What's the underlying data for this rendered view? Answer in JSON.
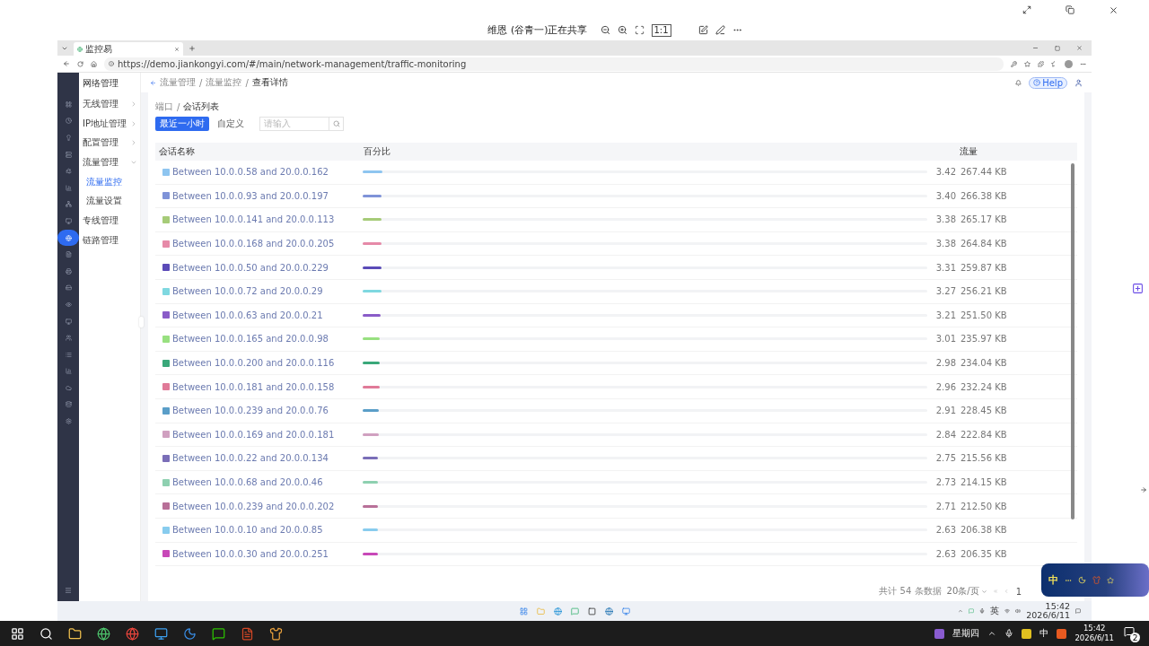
{
  "share_bar": {
    "text": "维恩 (谷青一)正在共享",
    "fit_label": "1:1"
  },
  "browser": {
    "tab_title": "监控易",
    "url": "https://demo.jiankongyi.com/#/main/network-management/traffic-monitoring"
  },
  "rail_items": [
    {
      "selected": false
    },
    {
      "selected": false
    },
    {
      "selected": false
    },
    {
      "selected": false
    },
    {
      "selected": false
    },
    {
      "selected": false
    },
    {
      "selected": false
    },
    {
      "selected": false
    },
    {
      "selected": true
    },
    {
      "selected": false
    },
    {
      "selected": false
    },
    {
      "selected": false
    },
    {
      "selected": false
    },
    {
      "selected": false
    },
    {
      "selected": false
    },
    {
      "selected": false
    },
    {
      "selected": false
    },
    {
      "selected": false
    },
    {
      "selected": false
    },
    {
      "selected": false
    }
  ],
  "sidebar": {
    "title": "网络管理",
    "items": [
      {
        "label": "无线管理",
        "expanded": false
      },
      {
        "label": "IP地址管理",
        "expanded": false
      },
      {
        "label": "配置管理",
        "expanded": false
      },
      {
        "label": "流量管理",
        "expanded": true,
        "children": [
          {
            "label": "流量监控",
            "selected": true
          },
          {
            "label": "流量设置",
            "selected": false
          }
        ]
      },
      {
        "label": "专线管理"
      },
      {
        "label": "链路管理"
      }
    ]
  },
  "header": {
    "breadcrumb": [
      "流量管理",
      "流量监控",
      "查看详情"
    ],
    "separator": "/",
    "help": "Help"
  },
  "content": {
    "breadcrumb": [
      "端口",
      "会话列表"
    ],
    "separator": "/",
    "ranges": [
      {
        "label": "最近一小时",
        "selected": true
      },
      {
        "label": "自定义",
        "selected": false
      }
    ],
    "search": {
      "placeholder": "请输入"
    },
    "columns": [
      "会话名称",
      "百分比",
      "流量"
    ],
    "rows": [
      {
        "name": "Between 10.0.0.58 and 20.0.0.162",
        "color": "#8ec5f0",
        "level": 0.0342,
        "percent": "3.42",
        "traffic": "267.44 KB"
      },
      {
        "name": "Between 10.0.0.93 and 20.0.0.197",
        "color": "#7f93d8",
        "level": 0.034,
        "percent": "3.40",
        "traffic": "266.38 KB"
      },
      {
        "name": "Between 10.0.0.141 and 20.0.0.113",
        "color": "#a6cb78",
        "level": 0.0338,
        "percent": "3.38",
        "traffic": "265.17 KB"
      },
      {
        "name": "Between 10.0.0.168 and 20.0.0.205",
        "color": "#e68aa8",
        "level": 0.0338,
        "percent": "3.38",
        "traffic": "264.84 KB"
      },
      {
        "name": "Between 10.0.0.50 and 20.0.0.229",
        "color": "#5b4bb8",
        "level": 0.0331,
        "percent": "3.31",
        "traffic": "259.87 KB"
      },
      {
        "name": "Between 10.0.0.72 and 20.0.0.29",
        "color": "#7fd8e0",
        "level": 0.0327,
        "percent": "3.27",
        "traffic": "256.21 KB"
      },
      {
        "name": "Between 10.0.0.63 and 20.0.0.21",
        "color": "#8a5cc8",
        "level": 0.0321,
        "percent": "3.21",
        "traffic": "251.50 KB"
      },
      {
        "name": "Between 10.0.0.165 and 20.0.0.98",
        "color": "#98e080",
        "level": 0.0301,
        "percent": "3.01",
        "traffic": "235.97 KB"
      },
      {
        "name": "Between 10.0.0.200 and 20.0.0.116",
        "color": "#3aa87a",
        "level": 0.0298,
        "percent": "2.98",
        "traffic": "234.04 KB"
      },
      {
        "name": "Between 10.0.0.181 and 20.0.0.158",
        "color": "#e07a98",
        "level": 0.0296,
        "percent": "2.96",
        "traffic": "232.24 KB"
      },
      {
        "name": "Between 10.0.0.239 and 20.0.0.76",
        "color": "#5a9ec8",
        "level": 0.0291,
        "percent": "2.91",
        "traffic": "228.45 KB"
      },
      {
        "name": "Between 10.0.0.169 and 20.0.0.181",
        "color": "#d0a0c0",
        "level": 0.0284,
        "percent": "2.84",
        "traffic": "222.84 KB"
      },
      {
        "name": "Between 10.0.0.22 and 20.0.0.134",
        "color": "#7a6eb8",
        "level": 0.0275,
        "percent": "2.75",
        "traffic": "215.56 KB"
      },
      {
        "name": "Between 10.0.0.68 and 20.0.0.46",
        "color": "#8ed0b0",
        "level": 0.0273,
        "percent": "2.73",
        "traffic": "214.15 KB"
      },
      {
        "name": "Between 10.0.0.239 and 20.0.0.202",
        "color": "#b87098",
        "level": 0.0271,
        "percent": "2.71",
        "traffic": "212.50 KB"
      },
      {
        "name": "Between 10.0.0.10 and 20.0.0.85",
        "color": "#88ccee",
        "level": 0.0263,
        "percent": "2.63",
        "traffic": "206.38 KB"
      },
      {
        "name": "Between 10.0.0.30 and 20.0.0.251",
        "color": "#c848b8",
        "level": 0.0263,
        "percent": "2.63",
        "traffic": "206.35 KB"
      }
    ],
    "pagination": {
      "total": "共计 54 条数据",
      "page_size": "20条/页",
      "page": "1"
    }
  },
  "inner_taskbar": {
    "ime": "英",
    "time": "15:42",
    "date": "2026/6/11"
  },
  "ime_widget": {
    "label": "中"
  },
  "taskbar": {
    "weekday": "星期四",
    "ime": "中",
    "time": "15:42",
    "date": "2026/6/11",
    "notifications": "2"
  }
}
